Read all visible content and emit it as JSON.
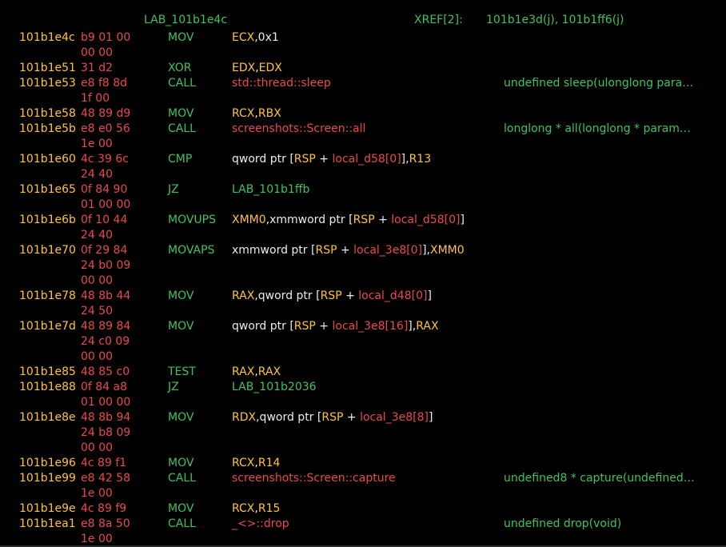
{
  "header": {
    "label": "LAB_101b1e4c",
    "xref_label": "XREF[2]:",
    "xref_value": "101b1e3d(j), 101b1ff6(j)"
  },
  "colors": {
    "background": "#000000",
    "address": "#ffc33a",
    "bytes": "#e84a4a",
    "mnemonic": "#3fc35b",
    "register": "#ffc33a",
    "symbol": "#e84a4a",
    "comment": "#3fc35b",
    "plain": "#ececec"
  },
  "rows": [
    {
      "address": "101b1e4c",
      "bytes": "b9 01 00",
      "mnemonic": "MOV",
      "operands": [
        {
          "t": "ECX",
          "k": "reg"
        },
        {
          "t": ",",
          "k": "plain"
        },
        {
          "t": "0x1",
          "k": "plain"
        }
      ],
      "comment": ""
    },
    {
      "address": "",
      "bytes": "00 00",
      "mnemonic": "",
      "operands": [],
      "comment": ""
    },
    {
      "address": "101b1e51",
      "bytes": "31 d2",
      "mnemonic": "XOR",
      "operands": [
        {
          "t": "EDX",
          "k": "reg"
        },
        {
          "t": ",",
          "k": "plain"
        },
        {
          "t": "EDX",
          "k": "reg"
        }
      ],
      "comment": ""
    },
    {
      "address": "101b1e53",
      "bytes": "e8 f8 8d",
      "mnemonic": "CALL",
      "operands": [
        {
          "t": "std::thread::sleep",
          "k": "sym"
        }
      ],
      "comment": "undefined sleep(ulonglong para…"
    },
    {
      "address": "",
      "bytes": "1f 00",
      "mnemonic": "",
      "operands": [],
      "comment": ""
    },
    {
      "address": "101b1e58",
      "bytes": "48 89 d9",
      "mnemonic": "MOV",
      "operands": [
        {
          "t": "RCX",
          "k": "reg"
        },
        {
          "t": ",",
          "k": "plain"
        },
        {
          "t": "RBX",
          "k": "reg"
        }
      ],
      "comment": ""
    },
    {
      "address": "101b1e5b",
      "bytes": "e8 e0 56",
      "mnemonic": "CALL",
      "operands": [
        {
          "t": "screenshots::Screen::all",
          "k": "sym"
        }
      ],
      "comment": "longlong * all(longlong * param…"
    },
    {
      "address": "",
      "bytes": "1e 00",
      "mnemonic": "",
      "operands": [],
      "comment": ""
    },
    {
      "address": "101b1e60",
      "bytes": "4c 39 6c",
      "mnemonic": "CMP",
      "operands": [
        {
          "t": "qword ptr [",
          "k": "plain"
        },
        {
          "t": "RSP",
          "k": "reg"
        },
        {
          "t": " + ",
          "k": "plain"
        },
        {
          "t": "local_d58[0]",
          "k": "sym"
        },
        {
          "t": "],",
          "k": "plain"
        },
        {
          "t": "R13",
          "k": "reg"
        }
      ],
      "comment": ""
    },
    {
      "address": "",
      "bytes": "24 40",
      "mnemonic": "",
      "operands": [],
      "comment": ""
    },
    {
      "address": "101b1e65",
      "bytes": "0f 84 90",
      "mnemonic": "JZ",
      "operands": [
        {
          "t": "LAB_101b1ffb",
          "k": "label"
        }
      ],
      "comment": ""
    },
    {
      "address": "",
      "bytes": "01 00 00",
      "mnemonic": "",
      "operands": [],
      "comment": ""
    },
    {
      "address": "101b1e6b",
      "bytes": "0f 10 44",
      "mnemonic": "MOVUPS",
      "operands": [
        {
          "t": "XMM0",
          "k": "reg"
        },
        {
          "t": ",xmmword ptr [",
          "k": "plain"
        },
        {
          "t": "RSP",
          "k": "reg"
        },
        {
          "t": " + ",
          "k": "plain"
        },
        {
          "t": "local_d58[0]",
          "k": "sym"
        },
        {
          "t": "]",
          "k": "plain"
        }
      ],
      "comment": ""
    },
    {
      "address": "",
      "bytes": "24 40",
      "mnemonic": "",
      "operands": [],
      "comment": ""
    },
    {
      "address": "101b1e70",
      "bytes": "0f 29 84",
      "mnemonic": "MOVAPS",
      "operands": [
        {
          "t": "xmmword ptr [",
          "k": "plain"
        },
        {
          "t": "RSP",
          "k": "reg"
        },
        {
          "t": " + ",
          "k": "plain"
        },
        {
          "t": "local_3e8[0]",
          "k": "sym"
        },
        {
          "t": "],",
          "k": "plain"
        },
        {
          "t": "XMM0",
          "k": "reg"
        }
      ],
      "comment": ""
    },
    {
      "address": "",
      "bytes": "24 b0 09",
      "mnemonic": "",
      "operands": [],
      "comment": ""
    },
    {
      "address": "",
      "bytes": "00 00",
      "mnemonic": "",
      "operands": [],
      "comment": ""
    },
    {
      "address": "101b1e78",
      "bytes": "48 8b 44",
      "mnemonic": "MOV",
      "operands": [
        {
          "t": "RAX",
          "k": "reg"
        },
        {
          "t": ",qword ptr [",
          "k": "plain"
        },
        {
          "t": "RSP",
          "k": "reg"
        },
        {
          "t": " + ",
          "k": "plain"
        },
        {
          "t": "local_d48[0]",
          "k": "sym"
        },
        {
          "t": "]",
          "k": "plain"
        }
      ],
      "comment": ""
    },
    {
      "address": "",
      "bytes": "24 50",
      "mnemonic": "",
      "operands": [],
      "comment": ""
    },
    {
      "address": "101b1e7d",
      "bytes": "48 89 84",
      "mnemonic": "MOV",
      "operands": [
        {
          "t": "qword ptr [",
          "k": "plain"
        },
        {
          "t": "RSP",
          "k": "reg"
        },
        {
          "t": " + ",
          "k": "plain"
        },
        {
          "t": "local_3e8[16]",
          "k": "sym"
        },
        {
          "t": "],",
          "k": "plain"
        },
        {
          "t": "RAX",
          "k": "reg"
        }
      ],
      "comment": ""
    },
    {
      "address": "",
      "bytes": "24 c0 09",
      "mnemonic": "",
      "operands": [],
      "comment": ""
    },
    {
      "address": "",
      "bytes": "00 00",
      "mnemonic": "",
      "operands": [],
      "comment": ""
    },
    {
      "address": "101b1e85",
      "bytes": "48 85 c0",
      "mnemonic": "TEST",
      "operands": [
        {
          "t": "RAX",
          "k": "reg"
        },
        {
          "t": ",",
          "k": "plain"
        },
        {
          "t": "RAX",
          "k": "reg"
        }
      ],
      "comment": ""
    },
    {
      "address": "101b1e88",
      "bytes": "0f 84 a8",
      "mnemonic": "JZ",
      "operands": [
        {
          "t": "LAB_101b2036",
          "k": "label"
        }
      ],
      "comment": ""
    },
    {
      "address": "",
      "bytes": "01 00 00",
      "mnemonic": "",
      "operands": [],
      "comment": ""
    },
    {
      "address": "101b1e8e",
      "bytes": "48 8b 94",
      "mnemonic": "MOV",
      "operands": [
        {
          "t": "RDX",
          "k": "reg"
        },
        {
          "t": ",qword ptr [",
          "k": "plain"
        },
        {
          "t": "RSP",
          "k": "reg"
        },
        {
          "t": " + ",
          "k": "plain"
        },
        {
          "t": "local_3e8[8]",
          "k": "sym"
        },
        {
          "t": "]",
          "k": "plain"
        }
      ],
      "comment": ""
    },
    {
      "address": "",
      "bytes": "24 b8 09",
      "mnemonic": "",
      "operands": [],
      "comment": ""
    },
    {
      "address": "",
      "bytes": "00 00",
      "mnemonic": "",
      "operands": [],
      "comment": ""
    },
    {
      "address": "101b1e96",
      "bytes": "4c 89 f1",
      "mnemonic": "MOV",
      "operands": [
        {
          "t": "RCX",
          "k": "reg"
        },
        {
          "t": ",",
          "k": "plain"
        },
        {
          "t": "R14",
          "k": "reg"
        }
      ],
      "comment": ""
    },
    {
      "address": "101b1e99",
      "bytes": "e8 42 58",
      "mnemonic": "CALL",
      "operands": [
        {
          "t": "screenshots::Screen::capture",
          "k": "sym"
        }
      ],
      "comment": "undefined8 * capture(undefined…"
    },
    {
      "address": "",
      "bytes": "1e 00",
      "mnemonic": "",
      "operands": [],
      "comment": ""
    },
    {
      "address": "101b1e9e",
      "bytes": "4c 89 f9",
      "mnemonic": "MOV",
      "operands": [
        {
          "t": "RCX",
          "k": "reg"
        },
        {
          "t": ",",
          "k": "plain"
        },
        {
          "t": "R15",
          "k": "reg"
        }
      ],
      "comment": ""
    },
    {
      "address": "101b1ea1",
      "bytes": "e8 8a 50",
      "mnemonic": "CALL",
      "operands": [
        {
          "t": "_<>::drop",
          "k": "sym"
        }
      ],
      "comment": "undefined drop(void)"
    },
    {
      "address": "",
      "bytes": "1e 00",
      "mnemonic": "",
      "operands": [],
      "comment": ""
    }
  ]
}
